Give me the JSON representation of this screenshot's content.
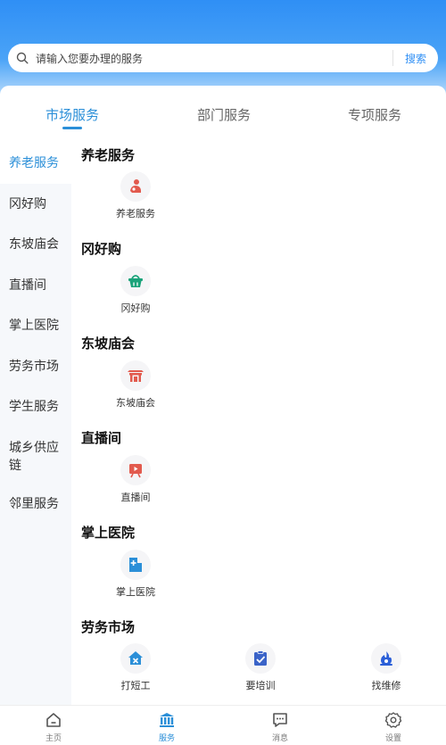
{
  "search": {
    "placeholder": "请输入您要办理的服务",
    "button": "搜索"
  },
  "tabs": [
    "市场服务",
    "部门服务",
    "专项服务"
  ],
  "sidebar": [
    "养老服务",
    "冈好购",
    "东坡庙会",
    "直播间",
    "掌上医院",
    "劳务市场",
    "学生服务",
    "城乡供应链",
    "邻里服务"
  ],
  "sections": [
    {
      "title": "养老服务",
      "items": [
        {
          "label": "养老服务",
          "icon": "elderly-care-icon"
        }
      ]
    },
    {
      "title": "冈好购",
      "items": [
        {
          "label": "冈好购",
          "icon": "shopping-basket-icon"
        }
      ]
    },
    {
      "title": "东坡庙会",
      "items": [
        {
          "label": "东坡庙会",
          "icon": "temple-gate-icon"
        }
      ]
    },
    {
      "title": "直播间",
      "items": [
        {
          "label": "直播间",
          "icon": "live-stream-icon"
        }
      ]
    },
    {
      "title": "掌上医院",
      "items": [
        {
          "label": "掌上医院",
          "icon": "hospital-icon"
        }
      ]
    },
    {
      "title": "劳务市场",
      "items": [
        {
          "label": "打短工",
          "icon": "tools-house-icon"
        },
        {
          "label": "要培训",
          "icon": "training-checklist-icon"
        },
        {
          "label": "找维修",
          "icon": "repair-flame-icon"
        }
      ]
    }
  ],
  "bottom_nav": [
    {
      "label": "主页",
      "icon": "home-icon"
    },
    {
      "label": "服务",
      "icon": "bank-service-icon",
      "active": true
    },
    {
      "label": "消息",
      "icon": "message-icon"
    },
    {
      "label": "设置",
      "icon": "settings-gear-icon"
    }
  ],
  "colors": {
    "accent": "#2b8fd8",
    "header_top": "#2f8ff5",
    "icon_red": "#e25a4e",
    "icon_green": "#1aa37a",
    "icon_blue": "#2b8fd8"
  }
}
